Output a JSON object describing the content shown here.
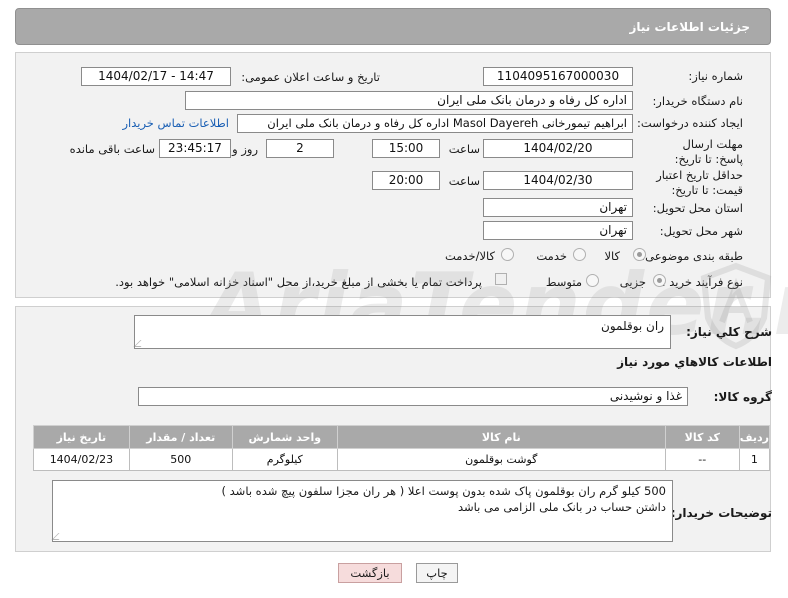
{
  "header": {
    "title": "جزئیات اطلاعات نیاز"
  },
  "form": {
    "need_number_label": "شماره نیاز:",
    "need_number": "1104095167000030",
    "announce_label": "تاریخ و ساعت اعلان عمومی:",
    "announce_value": "1404/02/17 - 14:47",
    "buyer_org_label": "نام دستگاه خریدار:",
    "buyer_org": "اداره کل رفاه و درمان بانک ملی ایران",
    "creator_label": "ایجاد کننده درخواست:",
    "creator": "ابراهیم تیمورخانی Masol Dayereh اداره کل رفاه و درمان بانک ملی ایران",
    "contact_link": "اطلاعات تماس خریدار",
    "deadline_label": "مهلت ارسال پاسخ: تا تاریخ:",
    "deadline_date": "1404/02/20",
    "time_label": "ساعت",
    "deadline_time": "15:00",
    "days_value": "2",
    "days_and_label": "روز و",
    "remaining_time": "23:45:17",
    "remaining_label": "ساعت باقی مانده",
    "price_validity_label": "حداقل تاریخ اعتبار قیمت: تا تاریخ:",
    "price_validity_date": "1404/02/30",
    "price_validity_time": "20:00",
    "province_label": "استان محل تحویل:",
    "province": "تهران",
    "city_label": "شهر محل تحویل:",
    "city": "تهران",
    "category_label": "طبقه بندی موضوعی:",
    "category_options": [
      "کالا",
      "خدمت",
      "کالا/خدمت"
    ],
    "category_selected": "کالا",
    "process_label": "نوع فرآیند خرید :",
    "process_options": [
      "جزیی",
      "متوسط"
    ],
    "process_selected": "جزیی",
    "payment_note": "پرداخت تمام یا بخشی از مبلغ خرید،از محل \"اسناد خزانه اسلامی\" خواهد بود."
  },
  "details": {
    "summary_label": "شرح كلي نياز:",
    "summary": "ران بوقلمون",
    "goods_info_title": "اطلاعات کالاهاي مورد نياز",
    "goods_group_label": "گروه کالا:",
    "goods_group": "غذا و نوشیدنی",
    "table": {
      "headers": [
        "رديف",
        "کد کالا",
        "نام کالا",
        "واحد شمارش",
        "تعداد / مقدار",
        "تاريخ نياز"
      ],
      "rows": [
        [
          "1",
          "--",
          "گوشت بوقلمون",
          "کیلوگرم",
          "500",
          "1404/02/23"
        ]
      ]
    },
    "buyer_notes_label": "توضیحات خریدار:",
    "buyer_notes_line1": "500 کیلو گرم ران بوقلمون پاک شده بدون پوست اعلا ( هر ران مجزا سلفون پیچ شده باشد )",
    "buyer_notes_line2": "داشتن حساب در بانک ملی الزامی می باشد"
  },
  "buttons": {
    "print": "چاپ",
    "back": "بازگشت"
  },
  "watermark": {
    "text": "AriaTender.net"
  },
  "colors": {
    "header_bg": "#a9a9a9",
    "link": "#1a5fb4",
    "back_btn_bg": "#f6dcdc"
  }
}
